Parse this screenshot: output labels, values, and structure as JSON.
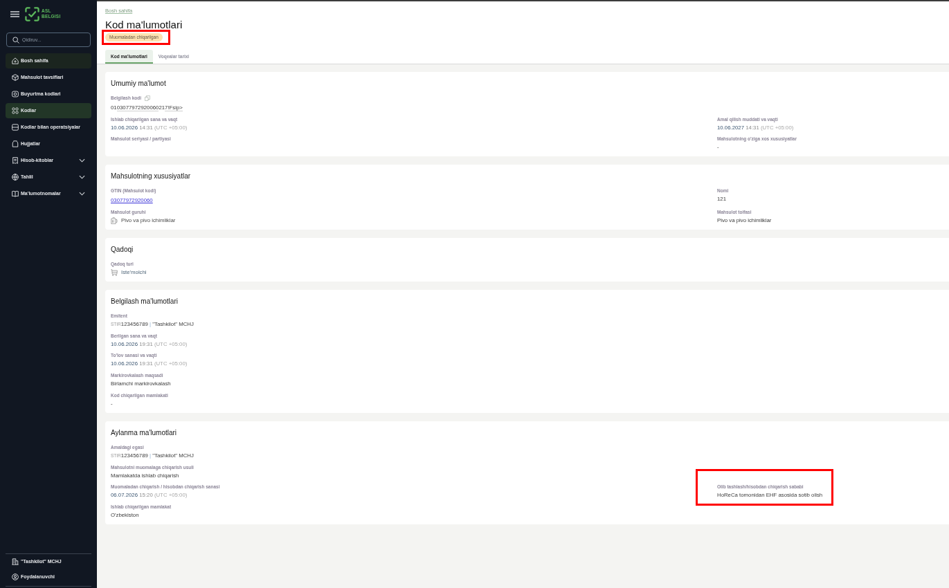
{
  "sidebar": {
    "logo": {
      "lines": [
        "ASL",
        "BELGISI"
      ]
    },
    "search": {
      "placeholder": "Qidiruv..."
    },
    "items": [
      {
        "label": "Bosh sahifa",
        "kind": "link",
        "selected": false,
        "hovered": true
      },
      {
        "label": "Mahsulot tavsiflari",
        "kind": "link",
        "selected": false,
        "hovered": false
      },
      {
        "label": "Buyurtma kodlari",
        "kind": "link",
        "selected": false,
        "hovered": false
      },
      {
        "label": "Kodlar",
        "kind": "link",
        "selected": true,
        "hovered": false
      },
      {
        "label": "Kodlar bilan operatsiyalar",
        "kind": "link",
        "selected": false,
        "hovered": false
      },
      {
        "label": "Hujjatlar",
        "kind": "link",
        "selected": false,
        "hovered": false
      },
      {
        "label": "Hisob-kitoblar",
        "kind": "group",
        "selected": false,
        "hovered": false,
        "expanded": false
      },
      {
        "label": "Tahlil",
        "kind": "group",
        "selected": false,
        "hovered": false,
        "expanded": false
      },
      {
        "label": "Ma'lumotnomalar",
        "kind": "group",
        "selected": false,
        "hovered": false,
        "expanded": false
      }
    ],
    "footer": [
      {
        "label": "\"Tashkilot\" MCHJ",
        "kind": "organization"
      },
      {
        "label": "Foydalanuvchi",
        "kind": "user"
      }
    ]
  },
  "breadcrumb": [
    "Bosh sahifa"
  ],
  "title": "Kod ma'lumotlari",
  "status": {
    "label": "Muomaladan chiqarilgan",
    "highlighted": true
  },
  "tabs": [
    {
      "label": "Kod ma'lumotlari",
      "selected": true
    },
    {
      "label": "Voqealar tarixi",
      "selected": false
    }
  ],
  "cards": [
    {
      "title": "Umumiy ma'lumot",
      "rows": [
        {
          "fields": [
            {
              "label": "Belgilash kodi",
              "kind": "code",
              "copyable": true,
              "highlighted": false,
              "segments": [
                {
                  "text": "01",
                  "underlined": false
                },
                {
                  "text": "03077972920060",
                  "underlined": true
                },
                {
                  "text": "21",
                  "underlined": false
                },
                {
                  "text": "7!Fsip>",
                  "underlined": true
                }
              ]
            }
          ]
        },
        {
          "fields": [
            {
              "label": "Ishlab chiqarilgan sana va vaqt",
              "kind": "datetime",
              "highlighted": false,
              "date": "10.06.2026",
              "time": "14:31",
              "zone": "(UTC +05:00)"
            },
            {
              "label": "Amal qilish muddati va vaqti",
              "kind": "datetime",
              "highlighted": false,
              "date": "10.06.2027",
              "time": "14:31",
              "zone": "(UTC +05:00)"
            }
          ]
        },
        {
          "fields": [
            {
              "label": "Mahsulot seriyasi / partiyasi",
              "kind": "text",
              "highlighted": false
            },
            {
              "label": "Mahsulotning o'ziga xos xususiyatlar",
              "kind": "text",
              "highlighted": false,
              "value": "-"
            }
          ]
        }
      ]
    },
    {
      "title": "Mahsulotning xususiyatlar",
      "rows": [
        {
          "fields": [
            {
              "label": "GTIN (Mahsulot kodi)",
              "kind": "link",
              "highlighted": false,
              "value": "03077972920060"
            },
            {
              "label": "Nomi",
              "kind": "text",
              "highlighted": false,
              "value": "121"
            }
          ]
        },
        {
          "fields": [
            {
              "label": "Mahsulot guruhi",
              "kind": "product_group",
              "highlighted": false,
              "value": "Pivo va pivo ichimliklar"
            },
            {
              "label": "Mahsulot toifasi",
              "kind": "text",
              "highlighted": false,
              "value": "Pivo va pivo ichimliklar"
            }
          ]
        }
      ]
    },
    {
      "title": "Qadoqi",
      "rows": [
        {
          "fields": [
            {
              "label": "Qadoq turi",
              "kind": "package",
              "highlighted": false,
              "value": "Iste'molchi"
            }
          ]
        }
      ]
    },
    {
      "title": "Belgilash ma'lumotlari",
      "rows": [
        {
          "fields": [
            {
              "label": "Emitent",
              "kind": "org",
              "highlighted": false,
              "prefix": "STIR",
              "inn": "123456789",
              "separator": "|",
              "name": "\"Tashkilot\" MCHJ"
            }
          ]
        },
        {
          "fields": [
            {
              "label": "Berilgan sana va vaqt",
              "kind": "datetime",
              "highlighted": false,
              "date": "10.06.2026",
              "time": "19:31",
              "zone": "(UTC +05:00)"
            }
          ]
        },
        {
          "fields": [
            {
              "label": "To'lov sanasi va vaqti",
              "kind": "datetime",
              "highlighted": false,
              "date": "10.06.2026",
              "time": "19:31",
              "zone": "(UTC +05:00)"
            }
          ]
        },
        {
          "fields": [
            {
              "label": "Markirovkalash maqsadi",
              "kind": "text",
              "highlighted": false,
              "value": "Birlamchi markirovkalash"
            }
          ]
        },
        {
          "fields": [
            {
              "label": "Kod chiqarilgan mamlakati",
              "kind": "text",
              "highlighted": false,
              "value": "-"
            }
          ]
        }
      ]
    },
    {
      "title": "Aylanma ma'lumotlari",
      "rows": [
        {
          "fields": [
            {
              "label": "Amaldagi egasi",
              "kind": "org",
              "highlighted": false,
              "prefix": "STIR",
              "inn": "123456789",
              "separator": "|",
              "name": "\"Tashkilot\" MCHJ"
            }
          ]
        },
        {
          "fields": [
            {
              "label": "Mahsulotni muomalaga chiqarish usuli",
              "kind": "text",
              "highlighted": false,
              "value": "Mamlakatda ishlab chiqarish"
            }
          ]
        },
        {
          "fields": [
            {
              "label": "Muomaladan chiqarish / hisobdan chiqarish sanasi",
              "kind": "datetime",
              "highlighted": false,
              "date": "06.07.2026",
              "time": "15:20",
              "zone": "(UTC +05:00)"
            },
            {
              "label": "Olib tashlash/hisobdan chiqarish sababi",
              "kind": "text",
              "highlighted": true,
              "value": "HoReCa tomonidan EHF asosida sotib olish"
            }
          ]
        },
        {
          "fields": [
            {
              "label": "Ishlab chiqarilgan mamlakat",
              "kind": "text",
              "highlighted": false,
              "value": "O'zbekiston"
            }
          ]
        }
      ]
    }
  ]
}
